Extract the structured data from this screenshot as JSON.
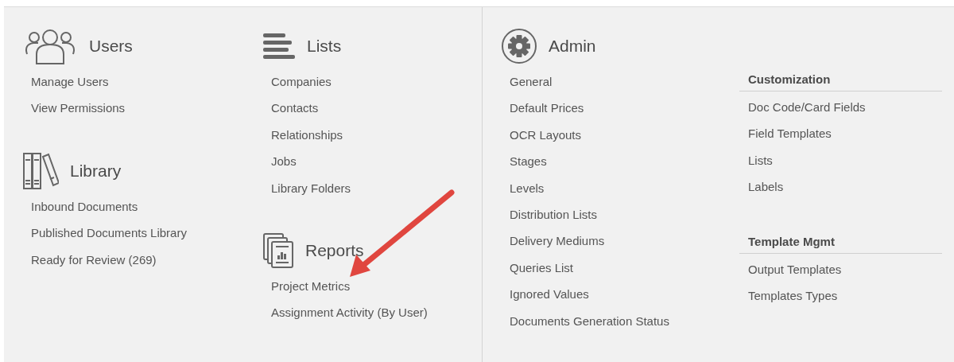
{
  "columns": [
    {
      "sections": [
        {
          "kind": "users",
          "title": "Users",
          "links": [
            "Manage Users",
            "View Permissions"
          ]
        },
        {
          "kind": "library",
          "title": "Library",
          "links": [
            "Inbound Documents",
            "Published Documents Library",
            "Ready for Review (269)"
          ]
        }
      ]
    },
    {
      "sections": [
        {
          "kind": "lists",
          "title": "Lists",
          "links": [
            "Companies",
            "Contacts",
            "Relationships",
            "Jobs",
            "Library Folders"
          ]
        },
        {
          "kind": "reports",
          "title": "Reports",
          "links": [
            "Project Metrics",
            "Assignment Activity (By User)"
          ]
        }
      ]
    }
  ],
  "admin": {
    "title": "Admin",
    "links": [
      "General",
      "Default Prices",
      "OCR Layouts",
      "Stages",
      "Levels",
      "Distribution Lists",
      "Delivery Mediums",
      "Queries List",
      "Ignored Values",
      "Documents Generation Status"
    ],
    "groups": [
      {
        "title": "Customization",
        "links": [
          "Doc Code/Card Fields",
          "Field Templates",
          "Lists",
          "Labels"
        ]
      },
      {
        "title": "Template Mgmt",
        "links": [
          "Output Templates",
          "Templates Types"
        ]
      }
    ]
  }
}
